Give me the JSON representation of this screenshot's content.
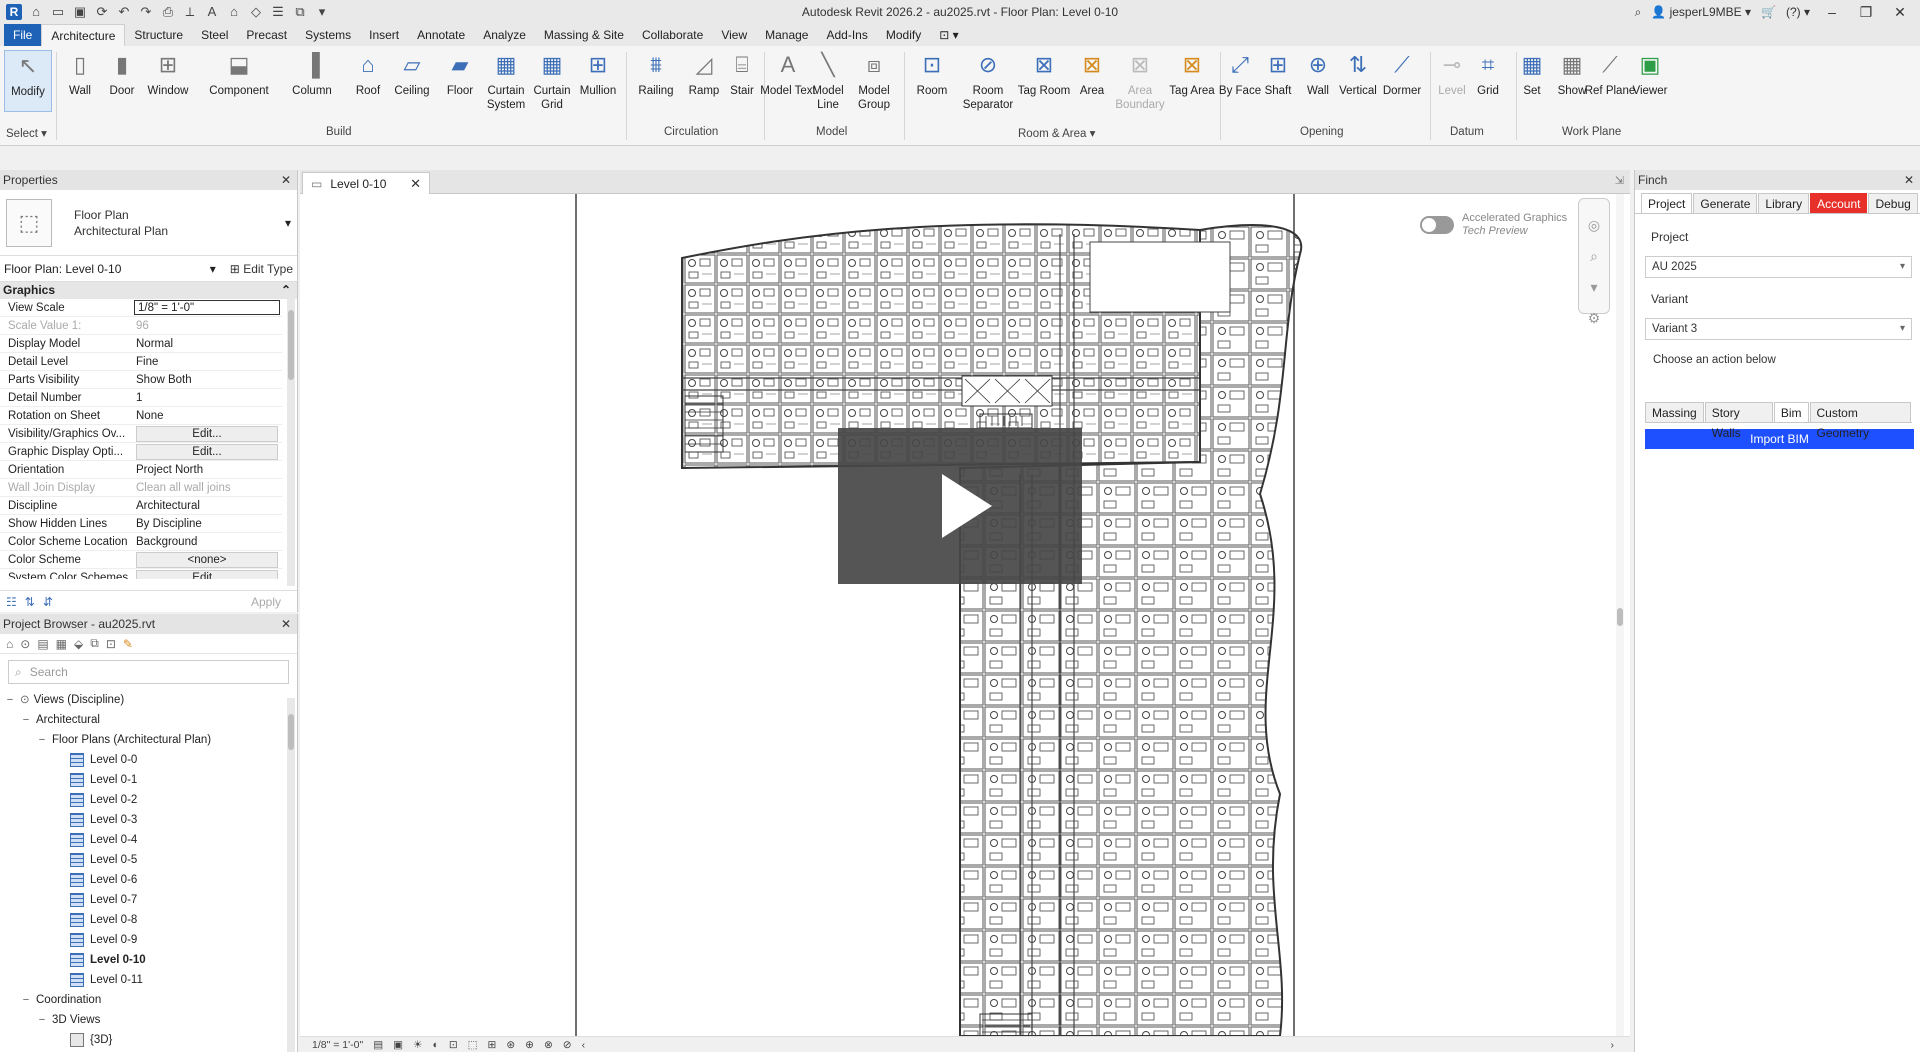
{
  "window": {
    "title": "Autodesk Revit 2026.2 - au2025.rvt - Floor Plan: Level 0-10",
    "user": "jesperL9MBE",
    "help_icon": "?"
  },
  "menu_tabs": [
    "File",
    "Architecture",
    "Structure",
    "Steel",
    "Precast",
    "Systems",
    "Insert",
    "Annotate",
    "Analyze",
    "Massing & Site",
    "Collaborate",
    "View",
    "Manage",
    "Add-Ins",
    "Modify"
  ],
  "ribbon": {
    "select": {
      "modify": "Modify",
      "panel": "Select"
    },
    "build": {
      "panel": "Build",
      "buttons": [
        "Wall",
        "Door",
        "Window",
        "Component",
        "Column",
        "Roof",
        "Ceiling",
        "Floor",
        "Curtain System",
        "Curtain Grid",
        "Mullion"
      ]
    },
    "circulation": {
      "panel": "Circulation",
      "buttons": [
        "Railing",
        "Ramp",
        "Stair"
      ]
    },
    "model": {
      "panel": "Model",
      "buttons": [
        "Model Text",
        "Model Line",
        "Model Group"
      ]
    },
    "room_area": {
      "panel": "Room & Area",
      "buttons": [
        "Room",
        "Room Separator",
        "Tag Room",
        "Area",
        "Area Boundary",
        "Tag Area"
      ]
    },
    "opening": {
      "panel": "Opening",
      "buttons": [
        "By Face",
        "Shaft",
        "Wall",
        "Vertical",
        "Dormer"
      ]
    },
    "datum": {
      "panel": "Datum",
      "buttons": [
        "Level",
        "Grid"
      ]
    },
    "work_plane": {
      "panel": "Work Plane",
      "buttons": [
        "Set",
        "Show",
        "Ref Plane",
        "Viewer"
      ]
    }
  },
  "properties": {
    "title": "Properties",
    "type_name": "Floor Plan",
    "type_sub": "Architectural Plan",
    "instance": "Floor Plan: Level 0-10",
    "edit_type": "Edit Type",
    "group": "Graphics",
    "rows": [
      {
        "k": "View Scale",
        "v": "1/8\" = 1'-0\""
      },
      {
        "k": "Scale Value    1:",
        "v": "96"
      },
      {
        "k": "Display Model",
        "v": "Normal"
      },
      {
        "k": "Detail Level",
        "v": "Fine"
      },
      {
        "k": "Parts Visibility",
        "v": "Show Both"
      },
      {
        "k": "Detail Number",
        "v": "1"
      },
      {
        "k": "Rotation on Sheet",
        "v": "None"
      },
      {
        "k": "Visibility/Graphics Ov...",
        "v": "Edit..."
      },
      {
        "k": "Graphic Display Opti...",
        "v": "Edit..."
      },
      {
        "k": "Orientation",
        "v": "Project North"
      },
      {
        "k": "Wall Join Display",
        "v": "Clean all wall joins"
      },
      {
        "k": "Discipline",
        "v": "Architectural"
      },
      {
        "k": "Show Hidden Lines",
        "v": "By Discipline"
      },
      {
        "k": "Color Scheme Location",
        "v": "Background"
      },
      {
        "k": "Color Scheme",
        "v": "<none>"
      },
      {
        "k": "System Color Schemes",
        "v": "Edit..."
      }
    ],
    "apply": "Apply"
  },
  "browser": {
    "title": "Project Browser - au2025.rvt",
    "search_placeholder": "Search",
    "views": "Views (Discipline)",
    "architectural": "Architectural",
    "floor_plans": "Floor Plans (Architectural Plan)",
    "levels": [
      "Level 0-0",
      "Level 0-1",
      "Level 0-2",
      "Level 0-3",
      "Level 0-4",
      "Level 0-5",
      "Level 0-6",
      "Level 0-7",
      "Level 0-8",
      "Level 0-9",
      "Level 0-10",
      "Level 0-11"
    ],
    "active_level": "Level 0-10",
    "coordination": "Coordination",
    "views3d": "3D Views",
    "view3d": "{3D}"
  },
  "view": {
    "tab": "Level 0-10",
    "accel_title": "Accelerated Graphics",
    "accel_sub": "Tech Preview",
    "scale": "1/8\" = 1'-0\""
  },
  "finch": {
    "title": "Finch",
    "tabs": [
      "Project",
      "Generate",
      "Library",
      "Account",
      "Debug"
    ],
    "project_label": "Project",
    "project_value": "AU 2025",
    "variant_label": "Variant",
    "variant_value": "Variant 3",
    "hint": "Choose an action below",
    "subtabs": [
      "Massing",
      "Story Walls",
      "Bim",
      "Custom Geometry"
    ],
    "import_button": "Import BIM"
  }
}
